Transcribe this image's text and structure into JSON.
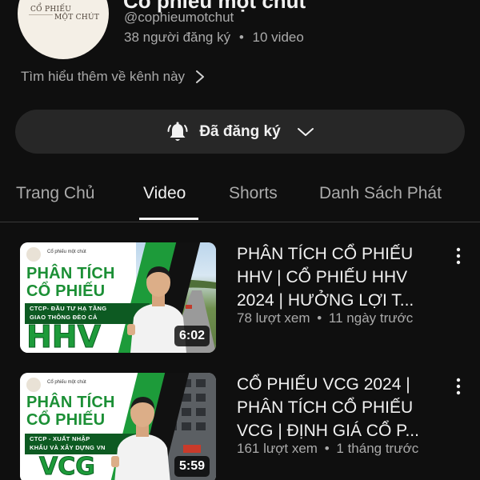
{
  "channel": {
    "name": "Cổ phiếu một chút",
    "handle": "@cophieumotchut",
    "subscribers": "38 người đăng ký",
    "separator": "•",
    "video_count": "10 video",
    "more_link": "Tìm hiểu thêm về kênh này",
    "avatar_text_line1": "CỔ PHIẾU",
    "avatar_text_line2": "MỘT CHÚT"
  },
  "subscribe_button": {
    "label": "Đã đăng ký",
    "icon": "bell-icon"
  },
  "tabs": [
    {
      "label": "Trang Chủ",
      "active": false
    },
    {
      "label": "Video",
      "active": true
    },
    {
      "label": "Shorts",
      "active": false
    },
    {
      "label": "Danh Sách Phát",
      "active": false
    }
  ],
  "videos": [
    {
      "title": "PHÂN TÍCH CỔ PHIẾU HHV | CỔ PHIẾU HHV 2024 | HƯỞNG LỢI T...",
      "views": "78 lượt xem",
      "age": "11 ngày trước",
      "duration": "6:02",
      "thumb": {
        "channel_small": "Cổ phiếu một chút",
        "line1": "PHÂN TÍCH",
        "line2": "CỔ PHIẾU",
        "strip_line1": "CTCP- ĐẦU TƯ HẠ TẦNG",
        "strip_line2": "GIAO THÔNG ĐÈO CẢ",
        "ticker": "HHV"
      }
    },
    {
      "title": "CỔ PHIẾU VCG 2024 | PHÂN TÍCH CỔ PHIẾU VCG | ĐỊNH GIÁ CỔ P...",
      "views": "161 lượt xem",
      "age": "1 tháng trước",
      "duration": "5:59",
      "thumb": {
        "channel_small": "Cổ phiếu một chút",
        "line1": "PHÂN TÍCH",
        "line2": "CỔ PHIẾU",
        "strip_line1": "CTCP - XUẤT NHẬP",
        "strip_line2": "KHẨU VÀ XÂY DỰNG VN",
        "ticker": "VCG"
      }
    }
  ],
  "colors": {
    "background": "#0f0f0f",
    "button_bg": "#272727",
    "text_primary": "#f1f1f1",
    "text_secondary": "#aaaaaa",
    "brand_green": "#1d9b3a"
  }
}
